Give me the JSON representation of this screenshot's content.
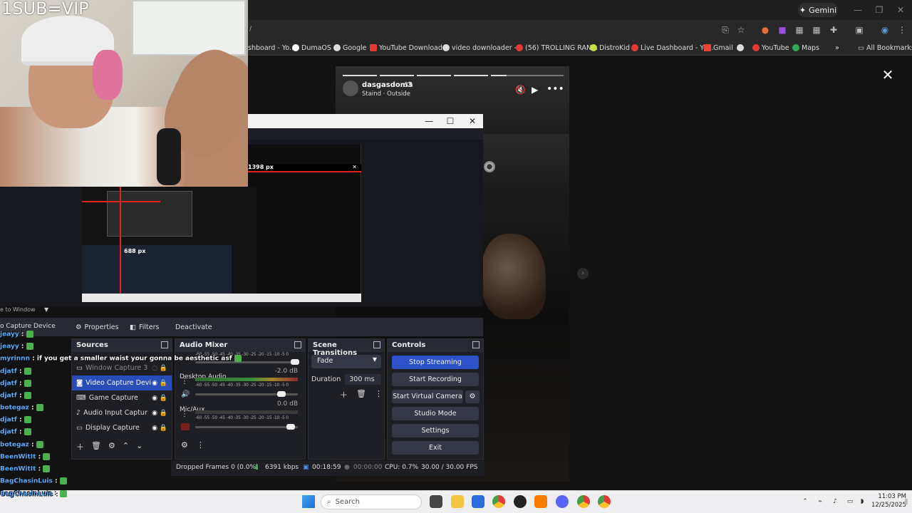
{
  "browser": {
    "gemini_label": "Gemini",
    "address_fragment": "/",
    "bookmarks": [
      "shboard - Yo...",
      "DumaOS",
      "Google",
      "YouTube Download...",
      "video downloader -...",
      "(56) TROLLING RAN...",
      "DistroKid",
      "Live Dashboard - Yo...",
      "Gmail",
      "YouTube",
      "Maps"
    ],
    "all_bookmarks": "All Bookmarks",
    "more_label": "»"
  },
  "story": {
    "username": "dasgasdom3",
    "time": "3h",
    "song": "Staind · Outside",
    "close_glyph": "✕",
    "next_glyph": "›"
  },
  "webcam": {
    "overlay_text": "1SUB=VIP"
  },
  "obs": {
    "preview_width_text": "1398 px",
    "preview_height_text": "688 px",
    "resize_text": "e to Window",
    "selected_source": "o Capture Device",
    "context": {
      "properties": "Properties",
      "filters": "Filters",
      "deactivate": "Deactivate"
    },
    "sources": {
      "title": "Sources",
      "items": [
        {
          "label": "Window Capture 3",
          "icon": "window-icon",
          "selected": false
        },
        {
          "label": "Video Capture Devi",
          "icon": "camera-icon",
          "selected": true
        },
        {
          "label": "Game Capture",
          "icon": "gamepad-icon",
          "selected": false
        },
        {
          "label": "Audio Input Captur",
          "icon": "mic-icon",
          "selected": false
        },
        {
          "label": "Display Capture",
          "icon": "monitor-icon",
          "selected": false
        }
      ]
    },
    "mixer": {
      "title": "Audio Mixer",
      "ticks": "-60 -55 -50 -45 -40 -35 -30 -25 -20 -15 -10 -5 0",
      "channels": [
        {
          "name": "Desktop Audio",
          "db": "-2.0 dB",
          "volume": 0.88
        },
        {
          "name": "Mic/Aux",
          "db": "0.0 dB",
          "volume": 0.97
        }
      ]
    },
    "transitions": {
      "title": "Scene Transitions",
      "selected": "Fade",
      "duration_label": "Duration",
      "duration_value": "300 ms"
    },
    "controls": {
      "title": "Controls",
      "buttons": [
        "Stop Streaming",
        "Start Recording",
        "Start Virtual Camera",
        "Studio Mode",
        "Settings",
        "Exit"
      ]
    },
    "status": {
      "dropped": "Dropped Frames 0 (0.0%)",
      "bitrate": "6391 kbps",
      "stream_time": "00:18:59",
      "rec_time": "00:00:00",
      "cpu": "CPU: 0.7%",
      "fps": "30.00 / 30.00 FPS"
    }
  },
  "chat": [
    {
      "name": "jeayy",
      "msg": ":"
    },
    {
      "name": "jeayy",
      "msg": ":"
    },
    {
      "name": "myrinnn",
      "msg": ": if you get a smaller waist your gonna be aesthetic asf"
    },
    {
      "name": "djatf",
      "msg": ":"
    },
    {
      "name": "djatf",
      "msg": ":"
    },
    {
      "name": "djatf",
      "msg": ":"
    },
    {
      "name": "botegaz",
      "msg": ":"
    },
    {
      "name": "djatf",
      "msg": ":"
    },
    {
      "name": "djatf",
      "msg": ":"
    },
    {
      "name": "botegaz",
      "msg": ":"
    },
    {
      "name": "BeenWitIt",
      "msg": ":"
    },
    {
      "name": "BeenWitIt",
      "msg": ":"
    },
    {
      "name": "BagChasinLuis",
      "msg": ":"
    },
    {
      "name": "BagChasinLuis",
      "msg": ":"
    }
  ],
  "taskbar": {
    "search_placeholder": "Search",
    "time": "11:03 PM",
    "date": "12/25/2025"
  },
  "colors": {
    "obs_primary": "#2c51c8",
    "chat_name": "#5ab1ff",
    "rec_red": "#e02424"
  }
}
